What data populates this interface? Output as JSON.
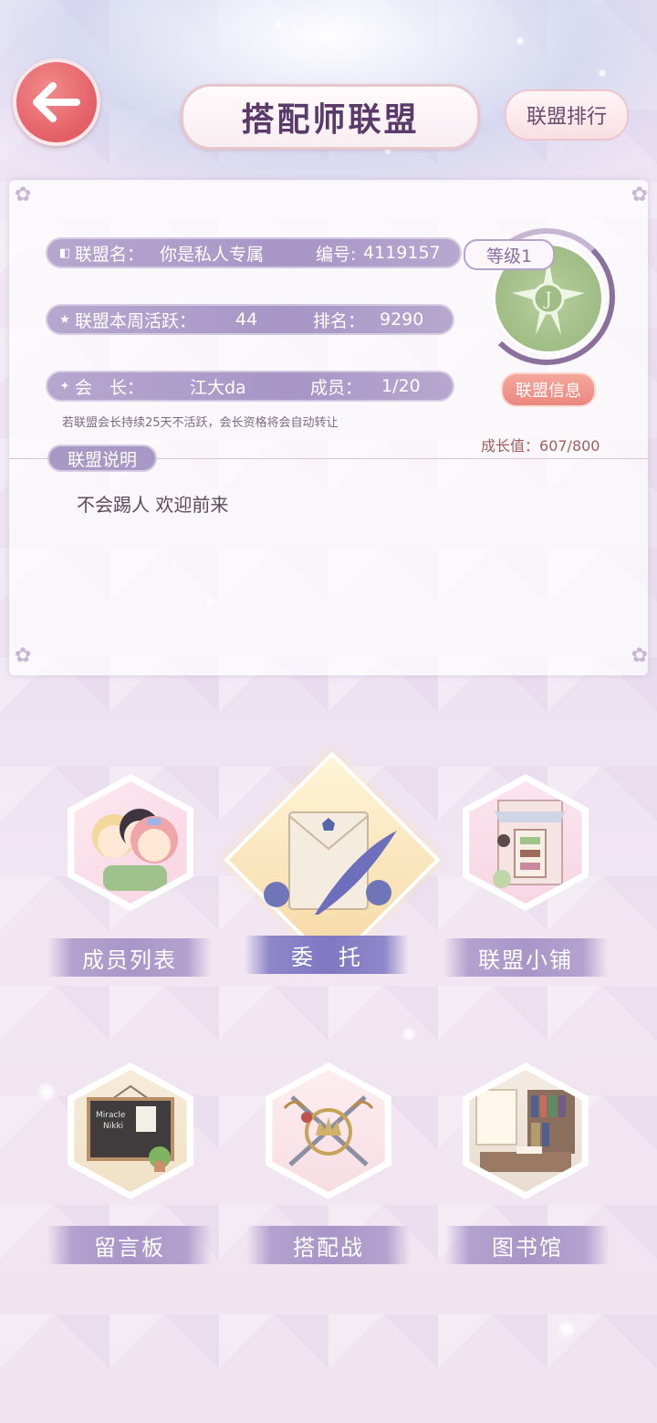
{
  "header": {
    "title": "搭配师联盟",
    "ranking_label": "联盟排行"
  },
  "alliance": {
    "name_label": "联盟名：",
    "name": "你是私人专属",
    "id_label": "编号:",
    "id": "4119157",
    "weekly_active_label": "联盟本周活跃：",
    "weekly_active": "44",
    "rank_label": "排名：",
    "rank": "9290",
    "leader_label": "会　长：",
    "leader": "江大da",
    "members_label": "成员：",
    "members": "1/20",
    "level": "等级1",
    "info_button": "联盟信息",
    "hint": "若联盟会长持续25天不活跃，会长资格将会自动转让",
    "growth_label": "成长值：",
    "growth": "607/800",
    "description_label": "联盟说明",
    "description": "不会踢人  欢迎前来"
  },
  "features": {
    "members": "成员列表",
    "commission": "委　托",
    "shop": "联盟小铺",
    "board": "留言板",
    "battle": "搭配战",
    "library": "图书馆"
  },
  "board_illustration": [
    "Miracle",
    "Nikki"
  ],
  "colors": {
    "pill": "#a796c6",
    "back_button": "#e35f67",
    "info_button": "#ea877e",
    "emblem": "#9fbd85"
  },
  "icons": [
    "back-arrow-icon",
    "book-icon",
    "star-icon",
    "sparkle-icon"
  ]
}
